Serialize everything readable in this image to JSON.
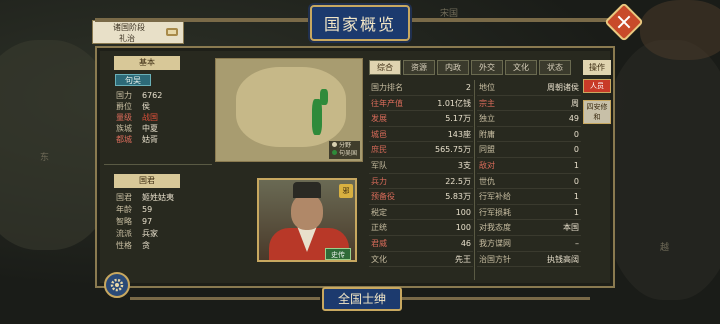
{
  "background": {
    "label_top": "宋国",
    "label_left": "东",
    "label_right": "越"
  },
  "stage": {
    "line1": "诸国阶段",
    "line2": "礼治",
    "icon": "scroll-icon"
  },
  "title": "国家概览",
  "basic": {
    "header": "基本",
    "state_name": "句吴",
    "rows": [
      {
        "k": "国力",
        "v": "6762",
        "red": false
      },
      {
        "k": "爵位",
        "v": "侯",
        "red": false
      },
      {
        "k": "量级",
        "v": "战国",
        "red": true
      },
      {
        "k": "族城",
        "v": "中夏",
        "red": false
      },
      {
        "k": "都城",
        "v": "姑胥",
        "red": true
      }
    ]
  },
  "ruler": {
    "header": "国君",
    "rows": [
      {
        "k": "国君",
        "v": "姬姓姑夷"
      },
      {
        "k": "年龄",
        "v": "59"
      },
      {
        "k": "智略",
        "v": "97"
      },
      {
        "k": "流派",
        "v": "兵家"
      },
      {
        "k": "性格",
        "v": "贪"
      }
    ],
    "portrait_tag": "邪",
    "bio_label": "史传"
  },
  "minimap": {
    "legend": [
      "分野",
      "句吴国"
    ]
  },
  "tabs": [
    "综合",
    "资源",
    "内政",
    "外交",
    "文化",
    "状态"
  ],
  "ops": {
    "title": "操作",
    "person_btn": "人员",
    "reform_btn": "四安修和"
  },
  "left_table": [
    {
      "k": "国力排名",
      "v": "2",
      "red": false
    },
    {
      "k": "往年产值",
      "v": "1.01亿钱",
      "red": true
    },
    {
      "k": "发展",
      "v": "5.17万",
      "red": true
    },
    {
      "k": "城邑",
      "v": "143座",
      "red": true
    },
    {
      "k": "庶民",
      "v": "565.75万",
      "red": true
    },
    {
      "k": "军队",
      "v": "3支",
      "red": false
    },
    {
      "k": "兵力",
      "v": "22.5万",
      "red": true
    },
    {
      "k": "预备役",
      "v": "5.83万",
      "red": true
    },
    {
      "k": "税定",
      "v": "100",
      "red": false
    },
    {
      "k": "正统",
      "v": "100",
      "red": false
    },
    {
      "k": "君威",
      "v": "46",
      "red": true
    },
    {
      "k": "文化",
      "v": "先王",
      "red": false
    }
  ],
  "right_table": [
    {
      "k": "地位",
      "v": "周朝诸侯",
      "red": false
    },
    {
      "k": "宗主",
      "v": "周",
      "red": true
    },
    {
      "k": "独立",
      "v": "49",
      "red": false
    },
    {
      "k": "附庸",
      "v": "0",
      "red": false
    },
    {
      "k": "同盟",
      "v": "0",
      "red": false
    },
    {
      "k": "敌对",
      "v": "1",
      "red": true
    },
    {
      "k": "世仇",
      "v": "0",
      "red": false
    },
    {
      "k": "行军补给",
      "v": "1",
      "red": false
    },
    {
      "k": "行军损耗",
      "v": "1",
      "red": false
    },
    {
      "k": "对我态度",
      "v": "本国",
      "red": false
    },
    {
      "k": "我方谍网",
      "v": "–",
      "red": false
    },
    {
      "k": "治国方针",
      "v": "执钱高阔",
      "red": false
    }
  ],
  "bottom": {
    "button": "全国士绅",
    "gear_icon": "gear-icon"
  },
  "colors": {
    "accent_gold": "#c8a860",
    "banner_blue": "#1c3a6e",
    "danger_red": "#c83a28",
    "map_green": "#2f8a3a"
  }
}
